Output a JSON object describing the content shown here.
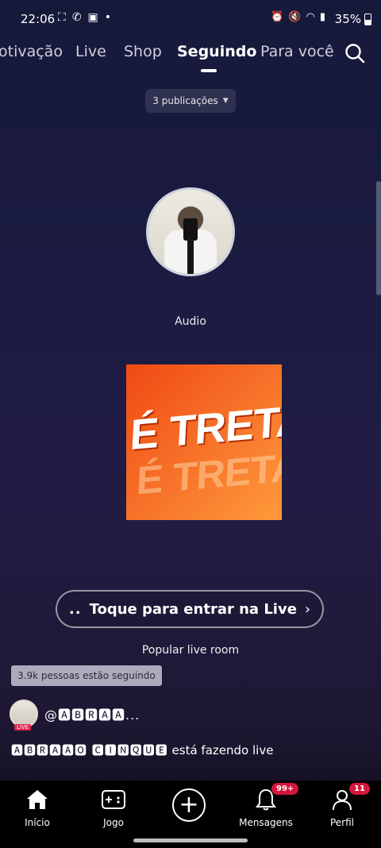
{
  "status_bar": {
    "time": "22:06",
    "battery": "35%",
    "network_label": "Voz WiFi"
  },
  "tabs": [
    {
      "label": "otivação"
    },
    {
      "label": "Live"
    },
    {
      "label": "Shop"
    },
    {
      "label": "Seguindo"
    },
    {
      "label": "Para você"
    }
  ],
  "publications_selector": {
    "label": "3 publicações"
  },
  "audio_label": "Audio",
  "cover": {
    "title": "É TRETA!"
  },
  "live_button": {
    "dots": "..",
    "label": "Toque para entrar na Live",
    "chevron": "›"
  },
  "popular_label": "Popular live room",
  "followers_badge": "3.9k pessoas estão seguindo",
  "live_tag": "LIVE",
  "user_handle": "@🅰🅱🆁🅰🅰...",
  "caption": {
    "name": "🅰🅱🆁🅰🅰🅾 🅲🅸🅽🆀🆄🅴",
    "text": " está fazendo live"
  },
  "bottom_nav": {
    "home": "Início",
    "game": "Jogo",
    "messages": "Mensagens",
    "messages_badge": "99+",
    "profile": "Perfil",
    "profile_badge": "11"
  }
}
